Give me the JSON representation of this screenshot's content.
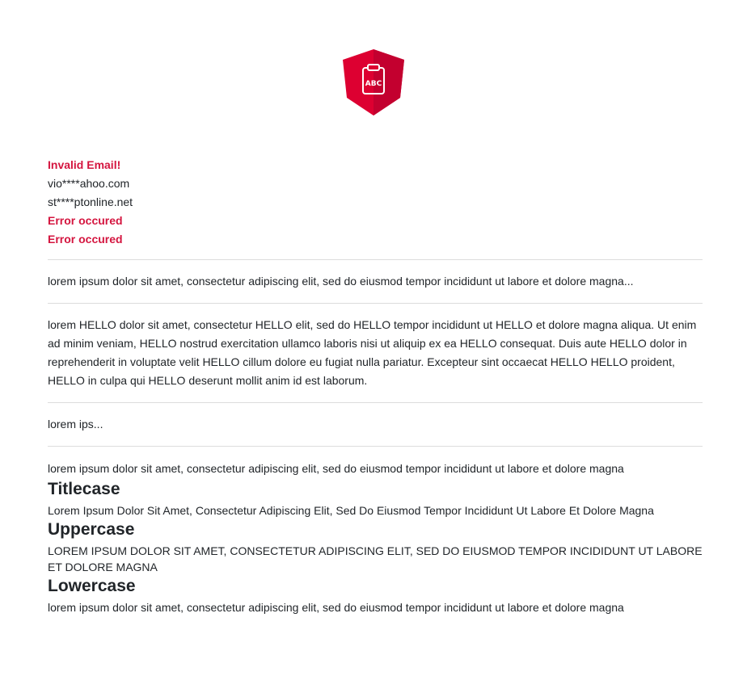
{
  "logo": {
    "icon": "clipboard-abc-icon",
    "text": "ABC",
    "color": "#dd0031"
  },
  "emails": [
    {
      "text": "Invalid Email!",
      "type": "error"
    },
    {
      "text": "vio****ahoo.com",
      "type": "normal"
    },
    {
      "text": "st****ptonline.net",
      "type": "normal"
    },
    {
      "text": "Error occured",
      "type": "error"
    },
    {
      "text": "Error occured",
      "type": "error"
    }
  ],
  "truncated_text": "lorem ipsum dolor sit amet, consectetur adipiscing elit, sed do eiusmod tempor incididunt ut labore et dolore magna...",
  "replaced_text": "lorem HELLO dolor sit amet, consectetur HELLO elit, sed do HELLO tempor incididunt ut HELLO et dolore magna aliqua. Ut enim ad minim veniam, HELLO nostrud exercitation ullamco laboris nisi ut aliquip ex ea HELLO consequat. Duis aute HELLO dolor in reprehenderit in voluptate velit HELLO cillum dolore eu fugiat nulla pariatur. Excepteur sint occaecat HELLO HELLO proident, HELLO in culpa qui HELLO deserunt mollit anim id est laborum.",
  "short_text": "lorem ips...",
  "plain_text": "lorem ipsum dolor sit amet, consectetur adipiscing elit, sed do eiusmod tempor incididunt ut labore et dolore magna",
  "titlecase": {
    "heading": "Titlecase",
    "text": "Lorem Ipsum Dolor Sit Amet, Consectetur Adipiscing Elit, Sed Do Eiusmod Tempor Incididunt Ut Labore Et Dolore Magna"
  },
  "uppercase": {
    "heading": "Uppercase",
    "text": "LOREM IPSUM DOLOR SIT AMET, CONSECTETUR ADIPISCING ELIT, SED DO EIUSMOD TEMPOR INCIDIDUNT UT LABORE ET DOLORE MAGNA"
  },
  "lowercase": {
    "heading": "Lowercase",
    "text": "lorem ipsum dolor sit amet, consectetur adipiscing elit, sed do eiusmod tempor incididunt ut labore et dolore magna"
  }
}
